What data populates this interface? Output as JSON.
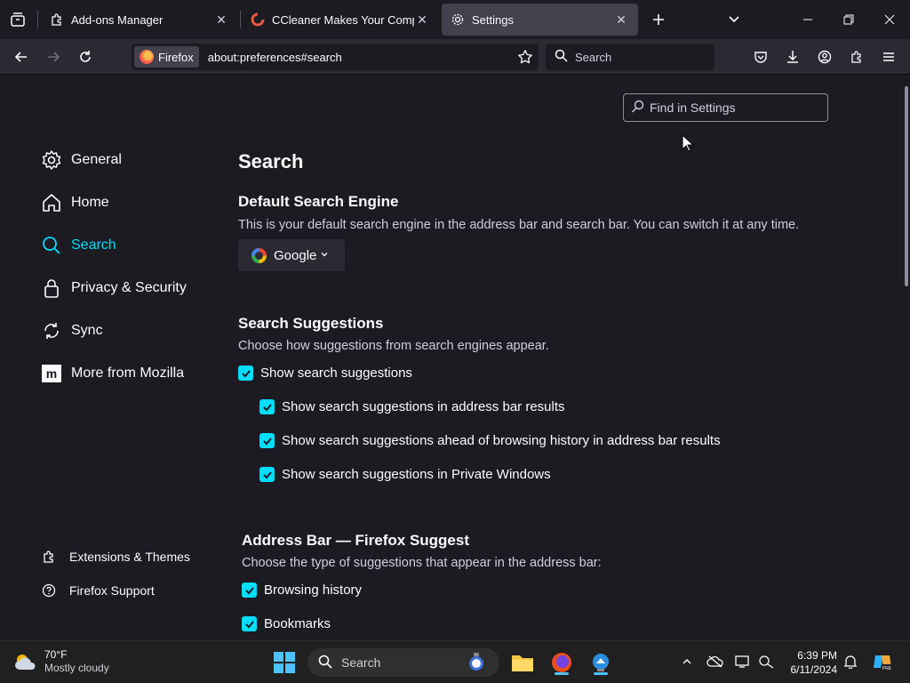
{
  "tabs": [
    {
      "title": "Add-ons Manager",
      "icon": "puzzle-icon",
      "active": false
    },
    {
      "title": "CCleaner Makes Your Compute",
      "icon": "ccleaner-icon",
      "active": false
    },
    {
      "title": "Settings",
      "icon": "gear-icon",
      "active": true
    }
  ],
  "urlbar": {
    "identity_label": "Firefox",
    "url": "about:preferences#search"
  },
  "searchbar": {
    "placeholder": "Search"
  },
  "find": {
    "placeholder": "Find in Settings"
  },
  "categories": [
    {
      "label": "General",
      "icon": "gear-icon"
    },
    {
      "label": "Home",
      "icon": "home-icon"
    },
    {
      "label": "Search",
      "icon": "search-icon",
      "selected": true
    },
    {
      "label": "Privacy & Security",
      "icon": "lock-icon"
    },
    {
      "label": "Sync",
      "icon": "sync-icon"
    },
    {
      "label": "More from Mozilla",
      "icon": "mozilla-icon"
    }
  ],
  "footer_links": [
    {
      "label": "Extensions & Themes",
      "icon": "puzzle-icon"
    },
    {
      "label": "Firefox Support",
      "icon": "help-icon"
    }
  ],
  "main": {
    "title": "Search",
    "default_engine": {
      "heading": "Default Search Engine",
      "description": "This is your default search engine in the address bar and search bar. You can switch it at any time.",
      "selected_engine": "Google"
    },
    "suggestions": {
      "heading": "Search Suggestions",
      "description": "Choose how suggestions from search engines appear.",
      "items": [
        {
          "label": "Show search suggestions",
          "checked": true
        },
        {
          "label": "Show search suggestions in address bar results",
          "checked": true
        },
        {
          "label": "Show search suggestions ahead of browsing history in address bar results",
          "checked": true
        },
        {
          "label": "Show search suggestions in Private Windows",
          "checked": true
        }
      ]
    },
    "address_bar": {
      "heading": "Address Bar — Firefox Suggest",
      "description": "Choose the type of suggestions that appear in the address bar:",
      "items": [
        {
          "label": "Browsing history",
          "checked": true
        },
        {
          "label": "Bookmarks",
          "checked": true
        }
      ]
    }
  },
  "taskbar": {
    "weather_temp": "70°F",
    "weather_desc": "Mostly cloudy",
    "search_placeholder": "Search",
    "time": "6:39 PM",
    "date": "6/11/2024"
  },
  "colors": {
    "accent": "#00ddff",
    "background": "#1c1b22",
    "toolbar": "#2b2a33"
  }
}
